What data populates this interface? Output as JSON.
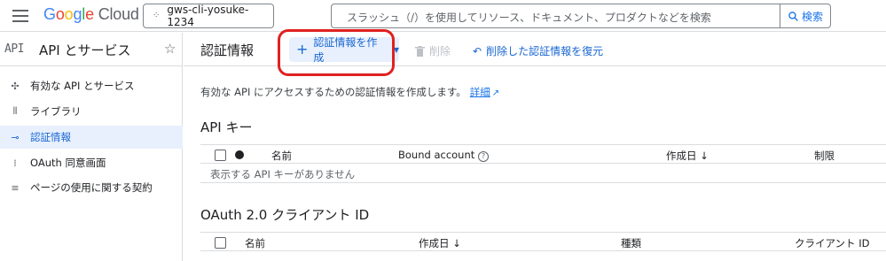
{
  "header": {
    "logo_parts": [
      "G",
      "o",
      "o",
      "g",
      "l",
      "e"
    ],
    "logo_cloud": "Cloud",
    "project_name": "gws-cli-yosuke-1234",
    "search_placeholder": "スラッシュ（/）を使用してリソース、ドキュメント、プロダクトなどを検索",
    "search_button": "検索"
  },
  "sidebar": {
    "api_logo": "API",
    "title": "API とサービス",
    "items": [
      {
        "label": "有効な API とサービス",
        "icon": "enabled-apis-icon",
        "active": false
      },
      {
        "label": "ライブラリ",
        "icon": "library-icon",
        "active": false
      },
      {
        "label": "認証情報",
        "icon": "key-icon",
        "active": true
      },
      {
        "label": "OAuth 同意画面",
        "icon": "oauth-consent-icon",
        "active": false
      },
      {
        "label": "ページの使用に関する契約",
        "icon": "agreements-icon",
        "active": false
      }
    ]
  },
  "main": {
    "title": "認証情報",
    "create_label": "認証情報を作成",
    "delete_label": "削除",
    "restore_label": "削除した認証情報を復元",
    "intro_text": "有効な API にアクセスするための認証情報を作成します。",
    "intro_link": "詳細",
    "api_keys": {
      "title": "API キー",
      "columns": [
        "名前",
        "Bound account",
        "作成日",
        "制限"
      ],
      "empty": "表示する API キーがありません"
    },
    "oauth": {
      "title": "OAuth 2.0 クライアント ID",
      "columns": [
        "名前",
        "作成日",
        "種類",
        "クライアント ID"
      ]
    }
  },
  "colors": {
    "accent": "#1a73e8",
    "active_bg": "#e8f0fe",
    "highlight": "#e02020"
  }
}
